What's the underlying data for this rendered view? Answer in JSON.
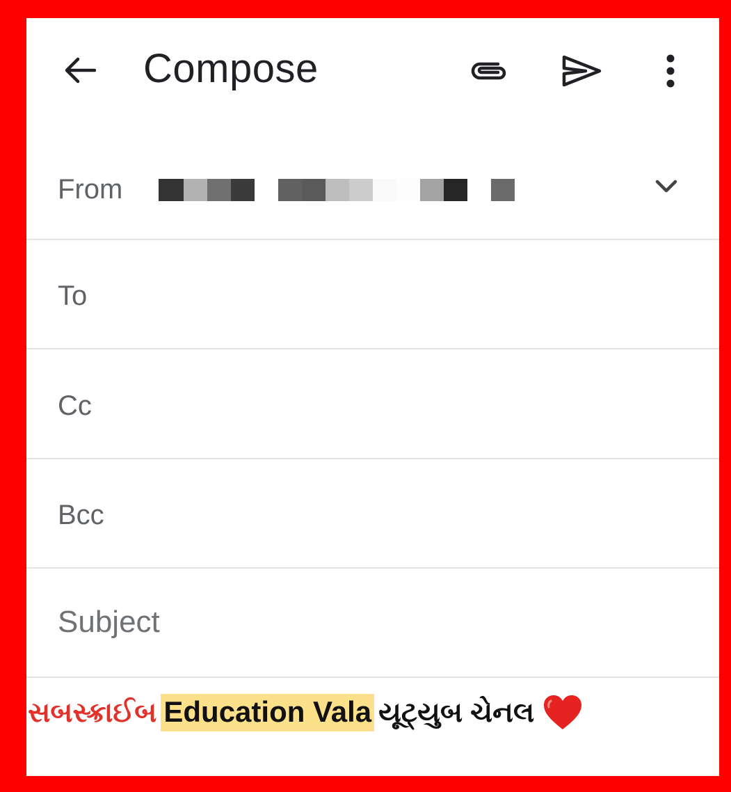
{
  "appbar": {
    "title": "Compose",
    "back_icon": "arrow-left-icon",
    "attach_icon": "paperclip-icon",
    "send_icon": "send-icon",
    "more_icon": "more-vert-icon"
  },
  "from": {
    "label": "From",
    "value_redacted": true,
    "dropdown_icon": "chevron-down-icon"
  },
  "fields": {
    "to": "To",
    "cc": "Cc",
    "bcc": "Bcc",
    "subject": "Subject"
  },
  "banner": {
    "gujarati_red": "સબસ્ક્રાઈબ",
    "english": "Education Vala",
    "gujarati_black": "યૂટ્યુબ ચેનલ",
    "heart_icon": "heart-icon",
    "colors": {
      "red": "#e0312b",
      "highlight": "#fde08a"
    }
  },
  "colors": {
    "frame_border": "#ff0000",
    "label_grey": "#5f6368",
    "title": "#202124"
  }
}
